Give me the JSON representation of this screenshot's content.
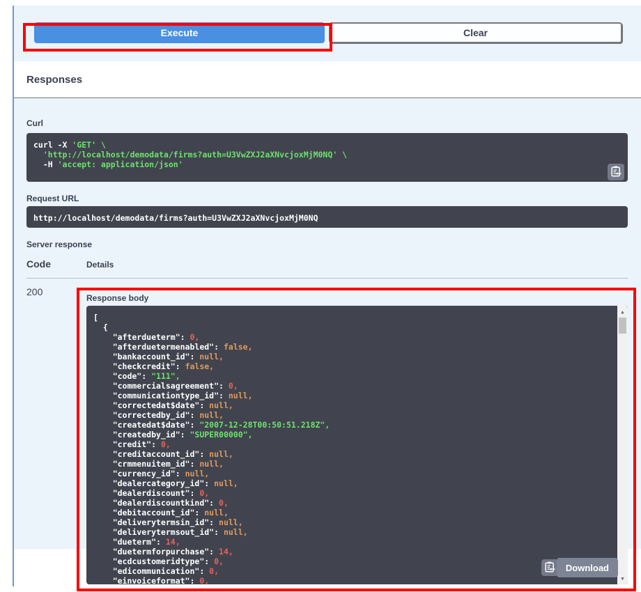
{
  "execute_section": {
    "execute_label": "Execute",
    "clear_label": "Clear"
  },
  "responses": {
    "title": "Responses"
  },
  "curl": {
    "label": "Curl",
    "lines": [
      [
        {
          "c": "p",
          "t": "curl -X "
        },
        {
          "c": "s",
          "t": "'GET'"
        },
        {
          "c": "s",
          "t": " \\"
        }
      ],
      [
        {
          "c": "s",
          "t": "  'http://localhost/demodata/firms?auth=U3VwZXJ2aXNvcjoxMjM0NQ' \\"
        }
      ],
      [
        {
          "c": "p",
          "t": "  -H "
        },
        {
          "c": "s",
          "t": "'accept: application/json'"
        }
      ]
    ]
  },
  "request_url": {
    "label": "Request URL",
    "value": "http://localhost/demodata/firms?auth=U3VwZXJ2aXNvcjoxMjM0NQ"
  },
  "server_response": {
    "label": "Server response",
    "code_header": "Code",
    "details_header": "Details",
    "code_value": "200",
    "response_body_label": "Response body",
    "download_label": "Download"
  },
  "response_body": {
    "lines": [
      [
        {
          "c": "p",
          "t": "["
        }
      ],
      [
        {
          "c": "p",
          "t": "  {"
        }
      ],
      [
        {
          "c": "p",
          "t": "    \"afterdueterm\": "
        },
        {
          "c": "n",
          "t": "0,"
        }
      ],
      [
        {
          "c": "p",
          "t": "    \"afterduetermenabled\": "
        },
        {
          "c": "l",
          "t": "false,"
        }
      ],
      [
        {
          "c": "p",
          "t": "    \"bankaccount_id\": "
        },
        {
          "c": "l",
          "t": "null,"
        }
      ],
      [
        {
          "c": "p",
          "t": "    \"checkcredit\": "
        },
        {
          "c": "l",
          "t": "false,"
        }
      ],
      [
        {
          "c": "p",
          "t": "    \"code\": "
        },
        {
          "c": "s",
          "t": "\"111\","
        }
      ],
      [
        {
          "c": "p",
          "t": "    \"commercialsagreement\": "
        },
        {
          "c": "n",
          "t": "0,"
        }
      ],
      [
        {
          "c": "p",
          "t": "    \"communicationtype_id\": "
        },
        {
          "c": "l",
          "t": "null,"
        }
      ],
      [
        {
          "c": "p",
          "t": "    \"correctedat$date\": "
        },
        {
          "c": "l",
          "t": "null,"
        }
      ],
      [
        {
          "c": "p",
          "t": "    \"correctedby_id\": "
        },
        {
          "c": "l",
          "t": "null,"
        }
      ],
      [
        {
          "c": "p",
          "t": "    \"createdat$date\": "
        },
        {
          "c": "s",
          "t": "\"2007-12-28T00:50:51.218Z\","
        }
      ],
      [
        {
          "c": "p",
          "t": "    \"createdby_id\": "
        },
        {
          "c": "s",
          "t": "\"SUPER00000\","
        }
      ],
      [
        {
          "c": "p",
          "t": "    \"credit\": "
        },
        {
          "c": "n",
          "t": "0,"
        }
      ],
      [
        {
          "c": "p",
          "t": "    \"creditaccount_id\": "
        },
        {
          "c": "l",
          "t": "null,"
        }
      ],
      [
        {
          "c": "p",
          "t": "    \"crmmenuitem_id\": "
        },
        {
          "c": "l",
          "t": "null,"
        }
      ],
      [
        {
          "c": "p",
          "t": "    \"currency_id\": "
        },
        {
          "c": "l",
          "t": "null,"
        }
      ],
      [
        {
          "c": "p",
          "t": "    \"dealercategory_id\": "
        },
        {
          "c": "l",
          "t": "null,"
        }
      ],
      [
        {
          "c": "p",
          "t": "    \"dealerdiscount\": "
        },
        {
          "c": "n",
          "t": "0,"
        }
      ],
      [
        {
          "c": "p",
          "t": "    \"dealerdiscountkind\": "
        },
        {
          "c": "n",
          "t": "0,"
        }
      ],
      [
        {
          "c": "p",
          "t": "    \"debitaccount_id\": "
        },
        {
          "c": "l",
          "t": "null,"
        }
      ],
      [
        {
          "c": "p",
          "t": "    \"deliverytermsin_id\": "
        },
        {
          "c": "l",
          "t": "null,"
        }
      ],
      [
        {
          "c": "p",
          "t": "    \"deliverytermsout_id\": "
        },
        {
          "c": "l",
          "t": "null,"
        }
      ],
      [
        {
          "c": "p",
          "t": "    \"dueterm\": "
        },
        {
          "c": "n",
          "t": "14,"
        }
      ],
      [
        {
          "c": "p",
          "t": "    \"duetermforpurchase\": "
        },
        {
          "c": "n",
          "t": "14,"
        }
      ],
      [
        {
          "c": "p",
          "t": "    \"ecdcustomeridtype\": "
        },
        {
          "c": "n",
          "t": "0,"
        }
      ],
      [
        {
          "c": "p",
          "t": "    \"edicommunication\": "
        },
        {
          "c": "n",
          "t": "0,"
        }
      ],
      [
        {
          "c": "p",
          "t": "    \"einvoiceformat\": "
        },
        {
          "c": "n",
          "t": "0,"
        }
      ]
    ]
  },
  "colors": {
    "annotation_red": "#ff0000",
    "execute_blue": "#4a90e2",
    "section_bg_blue": "#ebf3fb",
    "opblock_border_blue": "#6b9bd2",
    "code_block_dark": "#41444e",
    "response_block_dark": "#333333",
    "string_green": "#6ce26c",
    "number_red": "#e5635a",
    "literal_orange": "#e09a5c",
    "label_navy": "#3b4151",
    "button_gray": "#7d8493"
  }
}
